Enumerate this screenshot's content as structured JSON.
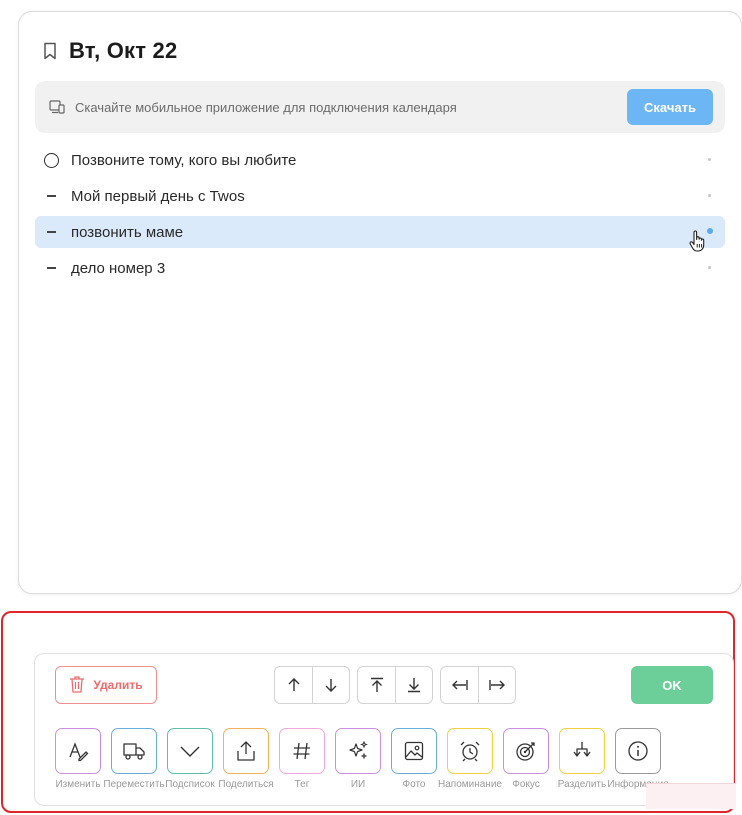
{
  "header": {
    "title": "Вт, Окт 22"
  },
  "banner": {
    "text": "Скачайте мобильное приложение для подключения календаря",
    "button_label": "Скачать"
  },
  "tasks": [
    {
      "text": "Позвоните тому, кого вы любите",
      "marker": "circle",
      "selected": false
    },
    {
      "text": "Мой первый день с Twos",
      "marker": "dash",
      "selected": false
    },
    {
      "text": "позвонить маме",
      "marker": "dash",
      "selected": true
    },
    {
      "text": "дело номер 3",
      "marker": "dash",
      "selected": false
    }
  ],
  "toolbar": {
    "delete_label": "Удалить",
    "ok_label": "OK",
    "actions": [
      {
        "label": "Изменить",
        "icon": "edit-icon",
        "color": "#c98fe0"
      },
      {
        "label": "Переместить",
        "icon": "truck-icon",
        "color": "#6aaee0"
      },
      {
        "label": "Подсписок",
        "icon": "chevron-down-icon",
        "color": "#5fbfa8"
      },
      {
        "label": "Поделиться",
        "icon": "share-icon",
        "color": "#f0b25c"
      },
      {
        "label": "Тег",
        "icon": "hashtag-icon",
        "color": "#f4a8d8"
      },
      {
        "label": "ИИ",
        "icon": "sparkle-icon",
        "color": "#c98fe0"
      },
      {
        "label": "Фото",
        "icon": "image-icon",
        "color": "#6aaee0"
      },
      {
        "label": "Напоминание",
        "icon": "alarm-icon",
        "color": "#f3d03e"
      },
      {
        "label": "Фокус",
        "icon": "target-icon",
        "color": "#c98fe0"
      },
      {
        "label": "Разделить",
        "icon": "split-icon",
        "color": "#f3d03e"
      },
      {
        "label": "Информация",
        "icon": "info-icon",
        "color": "#9a9a9a"
      }
    ]
  },
  "colors": {
    "accent_blue": "#6db6f5",
    "ok_green": "#6ccf9a",
    "delete_red": "#ee6b6b",
    "highlight_red": "#e0262b",
    "selected_row": "#dbeafa"
  }
}
